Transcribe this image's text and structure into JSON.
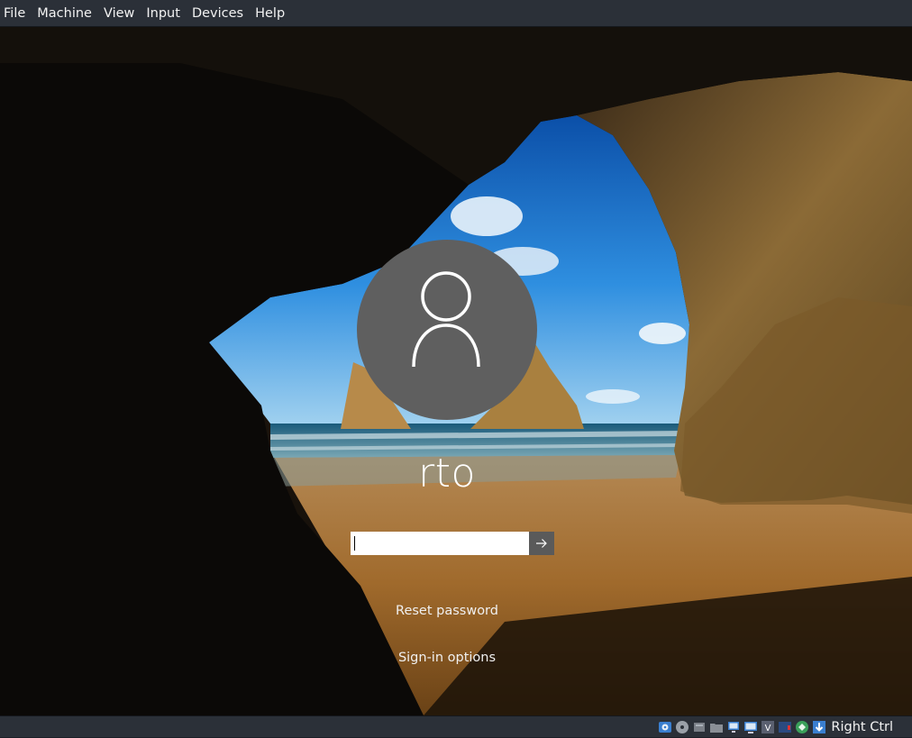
{
  "menubar": {
    "items": [
      "File",
      "Machine",
      "View",
      "Input",
      "Devices",
      "Help"
    ]
  },
  "lockscreen": {
    "username": "rto",
    "password_placeholder": "",
    "reset_password": "Reset password",
    "signin_options": "Sign-in options"
  },
  "statusbar": {
    "host_key": "Right Ctrl",
    "icons": [
      "hard-disk-icon",
      "optical-drive-icon",
      "audio-icon",
      "network-icon",
      "usb-icon",
      "shared-folders-icon",
      "display-icon",
      "recording-icon",
      "cpu-icon",
      "mouse-integration-icon",
      "keyboard-icon"
    ]
  }
}
